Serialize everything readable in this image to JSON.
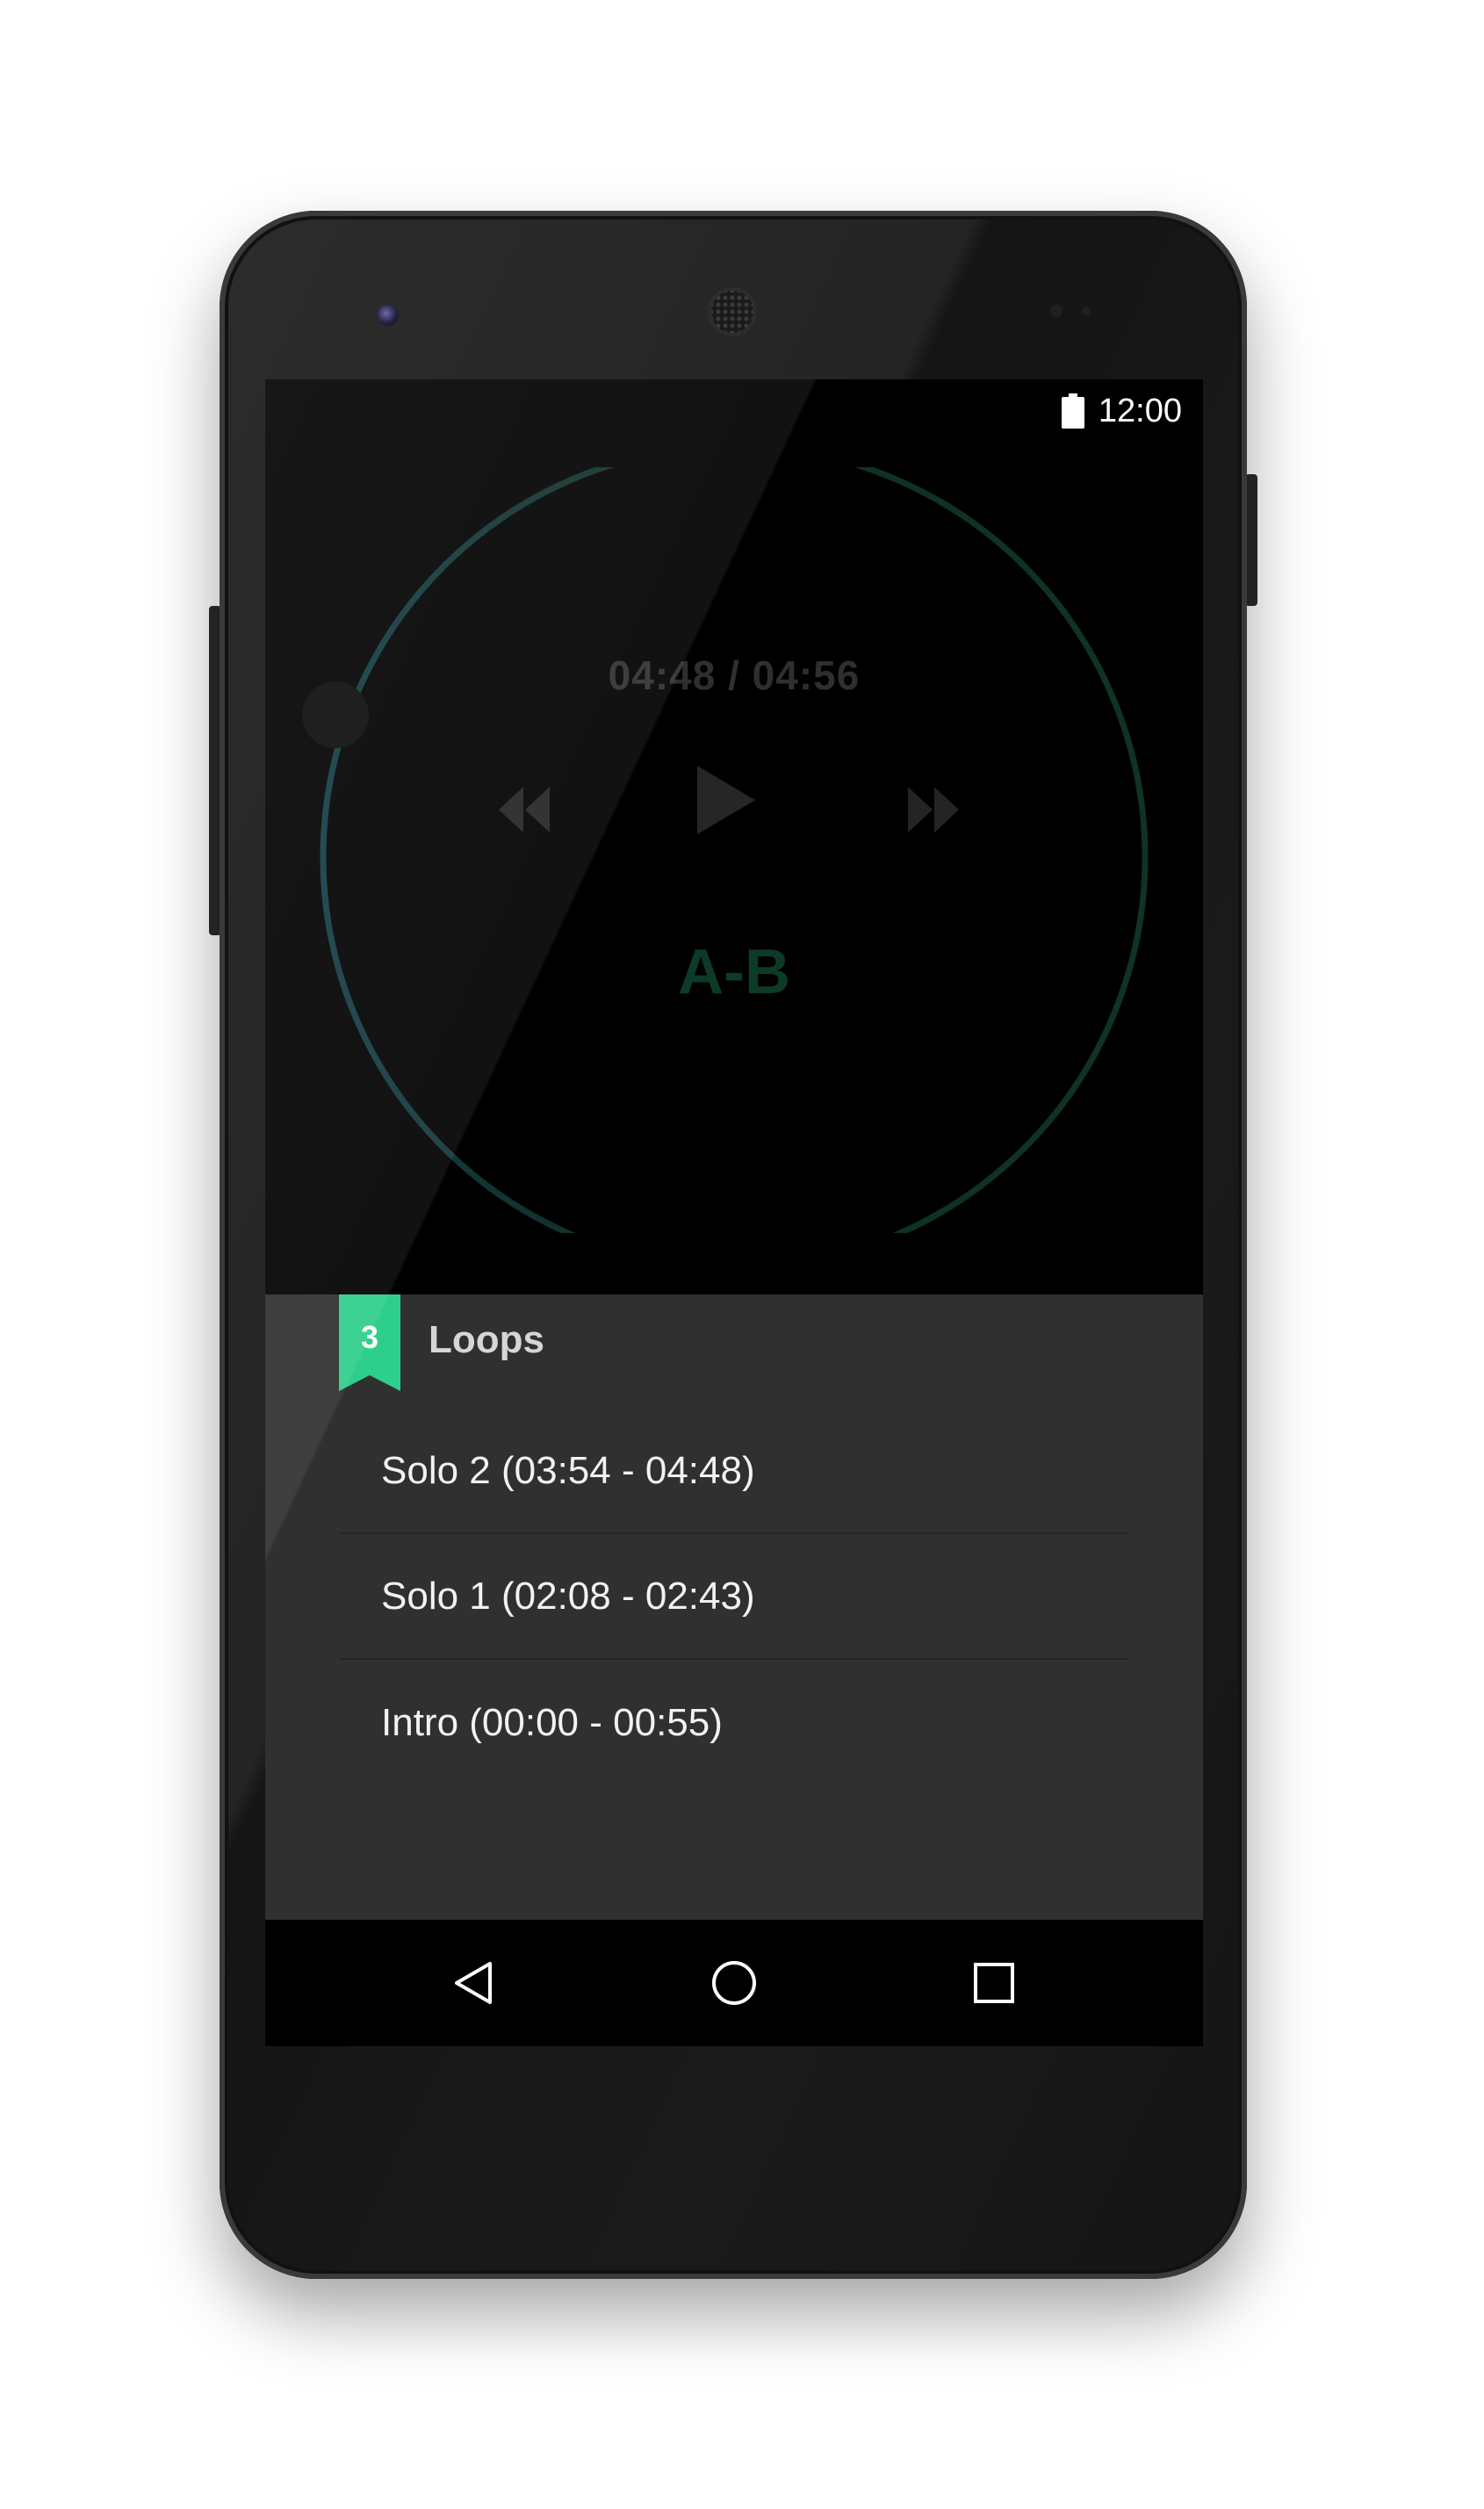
{
  "status_bar": {
    "time": "12:00",
    "battery_icon": "battery-full-icon"
  },
  "player": {
    "time_display": "04:48 / 04:56",
    "progress_fraction": 0.973,
    "controls": {
      "rewind_icon": "rewind-icon",
      "play_icon": "play-icon",
      "fast_forward_icon": "fast-forward-icon"
    },
    "ab_label": "A-B"
  },
  "loops": {
    "count": "3",
    "title": "Loops",
    "items": [
      {
        "label": "Solo 2 (03:54 - 04:48)"
      },
      {
        "label": "Solo 1 (02:08 - 02:43)"
      },
      {
        "label": "Intro (00:00 - 00:55)"
      }
    ]
  },
  "nav_bar": {
    "back_icon": "back-icon",
    "home_icon": "home-icon",
    "recents_icon": "recents-icon"
  },
  "colors": {
    "accent": "#2ecf8c",
    "ring": "#0f3324",
    "panel": "#303030",
    "screen": "#000000"
  }
}
